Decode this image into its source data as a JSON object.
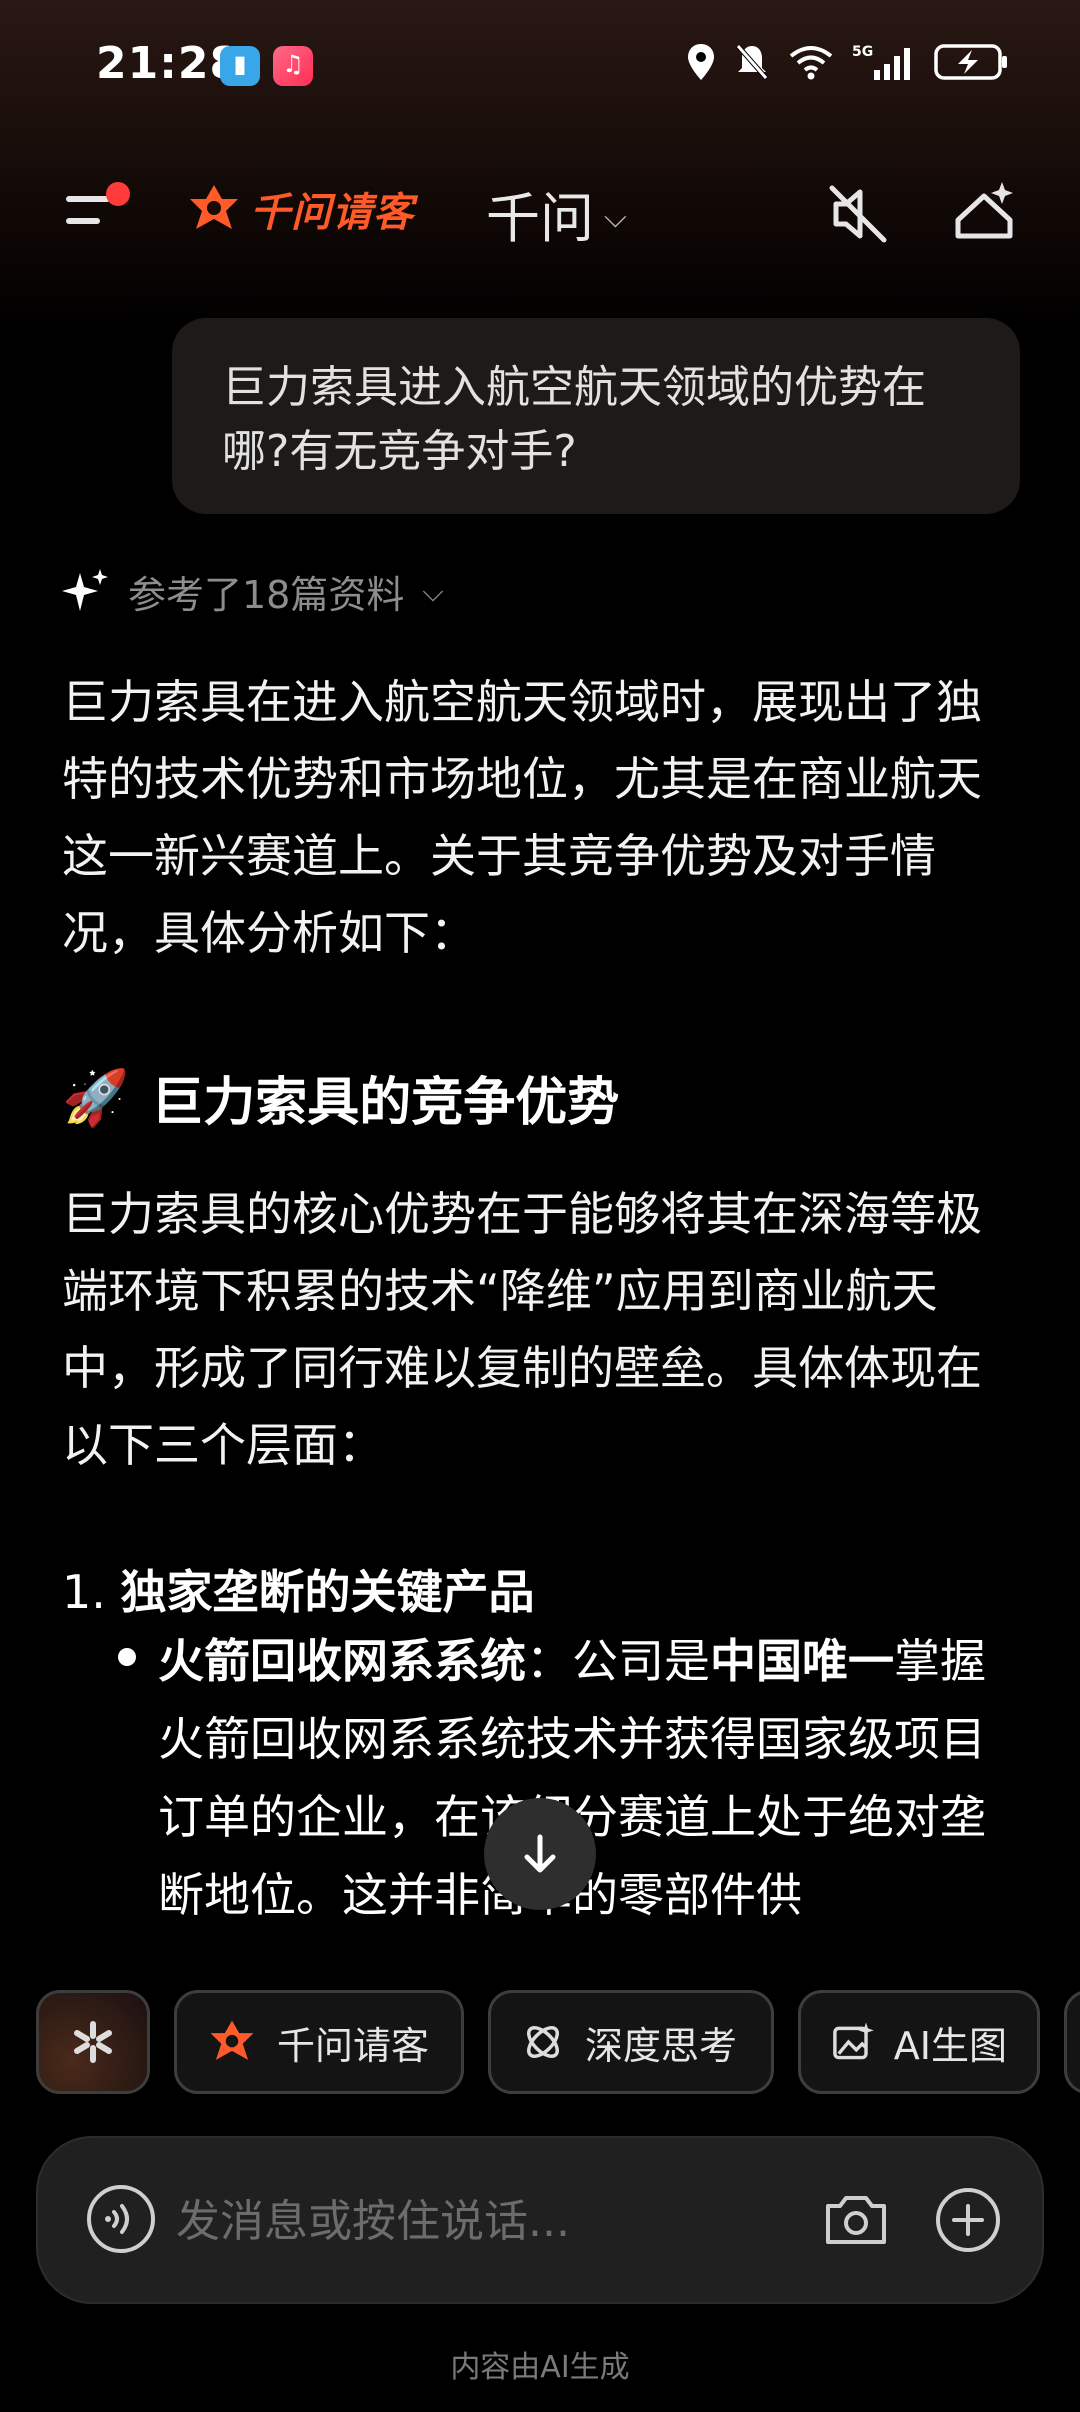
{
  "status_bar": {
    "time": "21:28"
  },
  "header": {
    "brand": "千问请客",
    "title": "千问"
  },
  "user_message": "巨力索具进入航空航天领域的优势在哪?有无竞争对手?",
  "refs": {
    "text": "参考了18篇资料"
  },
  "answer": {
    "intro": "巨力索具在进入航空航天领域时，展现出了独特的技术优势和市场地位，尤其是在商业航天这一新兴赛道上。关于其竞争优势及对手情况，具体分析如下：",
    "h2_emoji": "🚀",
    "h2_title": "巨力索具的竞争优势",
    "para2": "巨力索具的核心优势在于能够将其在深海等极端环境下积累的技术“降维”应用到商业航天中，形成了同行难以复制的壁垒。具体体现在以下三个层面：",
    "list_num": "1.",
    "list_title": "独家垄断的关键产品",
    "bullet_bold1": "火箭回收网系系统",
    "bullet_p1": "：公司是",
    "bullet_bold2": "中国唯一",
    "bullet_p2": "掌握火箭回收网系系统技术并获得国家级项目订单的企业，在该细分赛道上处于绝对垄断地位。这并非简单的零部件供"
  },
  "chips": [
    {
      "label": ""
    },
    {
      "label": "千问请客"
    },
    {
      "label": "深度思考"
    },
    {
      "label": "AI生图"
    }
  ],
  "input": {
    "placeholder": "发消息或按住说话..."
  },
  "footer": "内容由AI生成",
  "colors": {
    "background": "#000000",
    "brand_orange": "#ff5a2a",
    "bubble": "#1d1a18",
    "chip_border": "#3d3d3d"
  }
}
